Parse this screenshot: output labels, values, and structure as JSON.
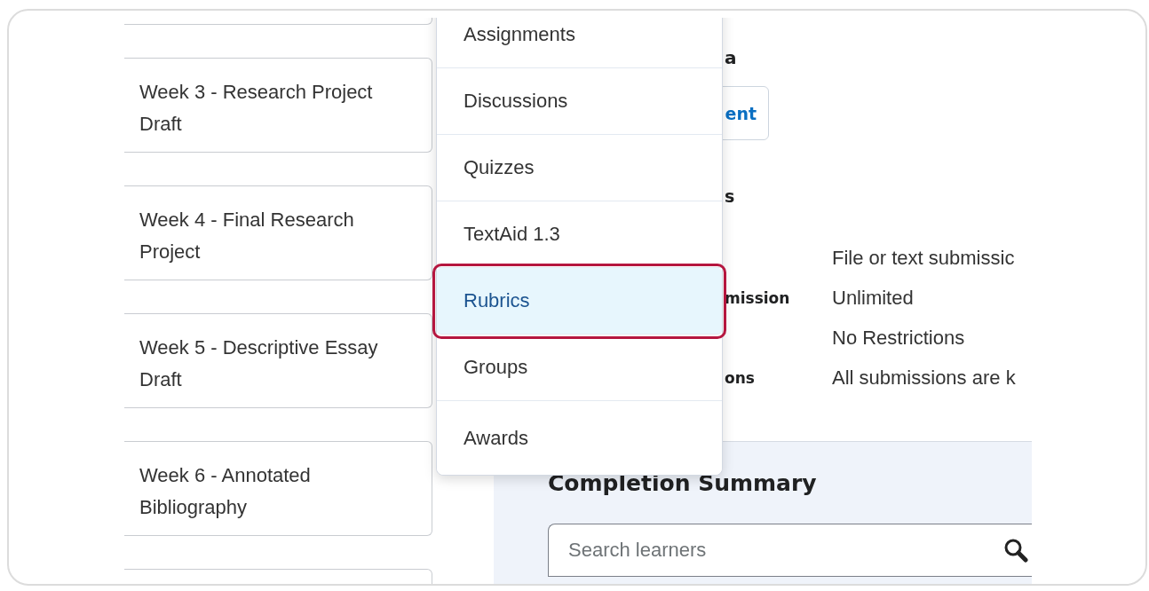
{
  "cards": [
    {
      "title": "Week 3 - Research Project Draft"
    },
    {
      "title": "Week 4 - Final Research Project"
    },
    {
      "title": "Week 5 - Descriptive Essay Draft"
    },
    {
      "title": "Week 6 - Annotated Bibliography"
    }
  ],
  "menu": [
    {
      "label": "Assignments",
      "selected": false
    },
    {
      "label": "Discussions",
      "selected": false
    },
    {
      "label": "Quizzes",
      "selected": false
    },
    {
      "label": "TextAid 1.3",
      "selected": false
    },
    {
      "label": "Rubrics",
      "selected": true
    },
    {
      "label": "Groups",
      "selected": false
    },
    {
      "label": "Awards",
      "selected": false
    }
  ],
  "details": {
    "heading": "a",
    "button": "ent",
    "subheading": "s",
    "rows": [
      {
        "value": "File or text submissic"
      },
      {
        "label": "mission",
        "value": "Unlimited"
      },
      {
        "value": "No Restrictions"
      },
      {
        "label": "ons",
        "value": "All submissions are k"
      }
    ]
  },
  "completion_summary": {
    "title": "Completion Summary",
    "search": {
      "placeholder": "Search learners"
    }
  }
}
